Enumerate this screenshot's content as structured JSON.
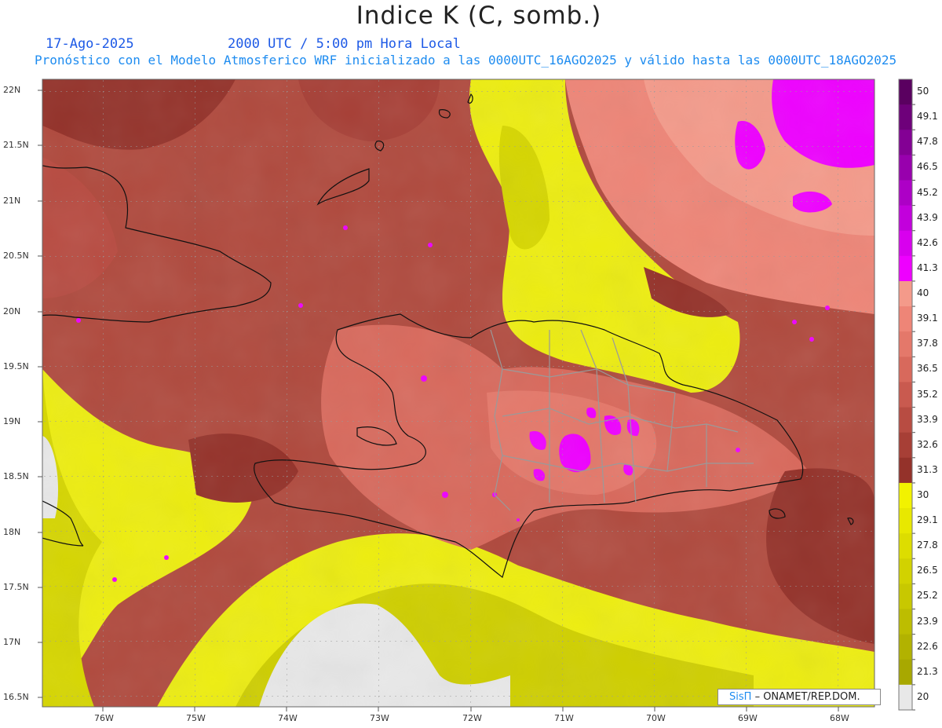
{
  "header": {
    "title": "Indice K (C, somb.)",
    "date": "17-Ago-2025",
    "time": "2000 UTC / 5:00 pm Hora Local",
    "model_line": "Pronóstico con el Modelo Atmosferico WRF inicializado a las 0000UTC_16AGO2025 y válido hasta las  0000UTC_18AGO2025"
  },
  "axes": {
    "lat_labels": [
      "22N",
      "21.5N",
      "21N",
      "20.5N",
      "20N",
      "19.5N",
      "19N",
      "18.5N",
      "18N",
      "17.5N",
      "17N",
      "16.5N"
    ],
    "lon_labels": [
      "76W",
      "75W",
      "74W",
      "73W",
      "72W",
      "71W",
      "70W",
      "69W",
      "68W"
    ]
  },
  "colorbar": {
    "labels": [
      "50",
      "49.1",
      "47.8",
      "46.5",
      "45.2",
      "43.9",
      "42.6",
      "41.3",
      "40",
      "39.1",
      "37.8",
      "36.5",
      "35.2",
      "33.9",
      "32.6",
      "31.3",
      "30",
      "29.1",
      "27.8",
      "26.5",
      "25.2",
      "23.9",
      "22.6",
      "21.3",
      "20"
    ],
    "colors": [
      "#5a0060",
      "#6e007a",
      "#830094",
      "#9800ad",
      "#ad00c6",
      "#c200dc",
      "#d800ee",
      "#ee00ff",
      "#f49a8a",
      "#ee8577",
      "#e4786a",
      "#d8695c",
      "#c95a4f",
      "#b84c42",
      "#a73f36",
      "#94322a",
      "#f2f200",
      "#e8e800",
      "#dddd00",
      "#d2d200",
      "#c8c800",
      "#bdbd00",
      "#b2b200",
      "#a8a800",
      "#e8e8e8"
    ]
  },
  "credit": {
    "brand": "SisΠ",
    "text": "– ONAMET/REP.DOM."
  }
}
